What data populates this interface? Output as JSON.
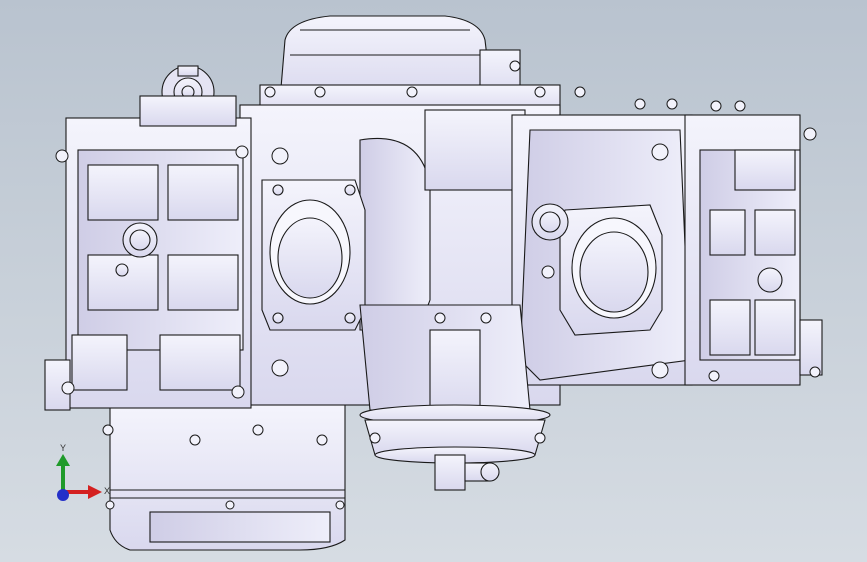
{
  "viewport": {
    "background_top": "#b9c3cf",
    "background_bottom": "#d6dce3",
    "part_fill": "#eeeefa",
    "part_shade": "#c9c8e2",
    "edge_color": "#1a1a1a"
  },
  "triad": {
    "x_label": "X",
    "y_label": "Y",
    "x_color": "#d42020",
    "y_color": "#1f9a2a",
    "z_color": "#2430c8"
  }
}
